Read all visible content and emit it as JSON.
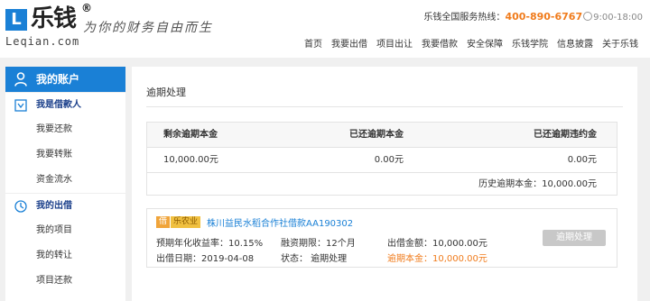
{
  "logo": {
    "box_letter": "L",
    "name": "乐钱",
    "reg_mark": "®",
    "url": "Leqian.com",
    "slogan": "为你的财务自由而生"
  },
  "hotline": {
    "label": "乐钱全国服务热线：",
    "number": "400-890-6767",
    "hours": "9:00-18:00"
  },
  "nav": [
    "首页",
    "我要出借",
    "项目出让",
    "我要借款",
    "安全保障",
    "乐钱学院",
    "信息披露",
    "关于乐钱"
  ],
  "sidebar": {
    "header": "我的账户",
    "sections": [
      {
        "title": "我是借款人",
        "items": [
          "我要还款",
          "我要转账",
          "资金流水"
        ]
      },
      {
        "title": "我的出借",
        "items": [
          "我的项目",
          "我的转让",
          "项目还款"
        ]
      }
    ]
  },
  "main": {
    "title": "逾期处理",
    "summary": {
      "headers": [
        "剩余逾期本金",
        "已还逾期本金",
        "已还逾期违约金"
      ],
      "values": [
        "10,000.00元",
        "0.00元",
        "0.00元"
      ],
      "footer": "历史逾期本金：10,000.00元"
    },
    "loan": {
      "tag_loan": "借",
      "tag_category": "乐农业",
      "title": "株川益民水稻合作社借款AA190302",
      "rate": "预期年化收益率：10.15%",
      "term": "融资期限：12个月",
      "amount": "出借金额：10,000.00元",
      "date": "出借日期：2019-04-08",
      "status": "状态：  逾期处理",
      "overdue": "逾期本金：10,000.00元",
      "button": "逾期处理"
    }
  }
}
